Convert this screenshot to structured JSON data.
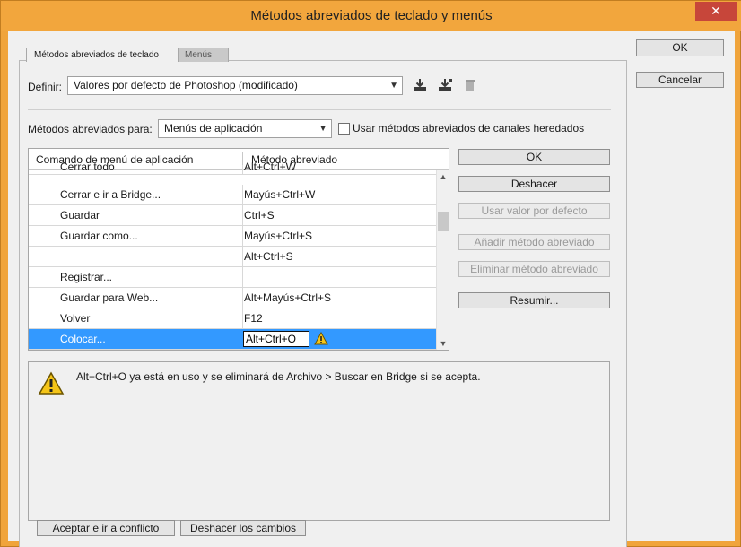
{
  "window": {
    "title": "Métodos abreviados de teclado y menús",
    "close_glyph": "✕"
  },
  "tabs": [
    {
      "label": "Métodos abreviados de teclado",
      "active": true
    },
    {
      "label": "Menús",
      "active": false
    }
  ],
  "define": {
    "label": "Definir:",
    "value": "Valores por defecto de Photoshop (modificado)",
    "icons": [
      "save-set-icon",
      "save-as-set-icon",
      "delete-set-icon"
    ]
  },
  "shortcuts_for": {
    "label": "Métodos abreviados para:",
    "value": "Menús de aplicación",
    "checkbox_label": "Usar métodos abreviados de canales heredados",
    "checkbox_checked": false
  },
  "table": {
    "columns": [
      "Comando de menú de aplicación",
      "Método abreviado"
    ],
    "rows": [
      {
        "command": "Cerrar todo",
        "shortcut": "Alt+Ctrl+W"
      },
      {
        "command": "Cerrar e ir a Bridge...",
        "shortcut": "Mayús+Ctrl+W"
      },
      {
        "command": "Guardar",
        "shortcut": "Ctrl+S"
      },
      {
        "command": "Guardar como...",
        "shortcut": "Mayús+Ctrl+S"
      },
      {
        "command": "",
        "shortcut": "Alt+Ctrl+S"
      },
      {
        "command": "Registrar...",
        "shortcut": ""
      },
      {
        "command": "Guardar para Web...",
        "shortcut": "Alt+Mayús+Ctrl+S"
      },
      {
        "command": "Volver",
        "shortcut": "F12"
      },
      {
        "command": "Colocar...",
        "shortcut": "Alt+Ctrl+O",
        "selected": true,
        "editing": true,
        "warning": true
      }
    ]
  },
  "side_buttons": {
    "ok": "OK",
    "undo": "Deshacer",
    "use_default": "Usar valor por defecto",
    "add_shortcut": "Añadir método abreviado",
    "delete_shortcut": "Eliminar método abreviado",
    "summarize": "Resumir..."
  },
  "message": "Alt+Ctrl+O ya está en uso y se eliminará de Archivo > Buscar en Bridge si se acepta.",
  "bottom_buttons": {
    "accept_conflict": "Aceptar e ir a conflicto",
    "undo_changes": "Deshacer los cambios"
  },
  "dialog_buttons": {
    "ok": "OK",
    "cancel": "Cancelar"
  },
  "colors": {
    "title_bar": "#f2a63d",
    "selection": "#3399ff",
    "close": "#c7463a",
    "warning": "#f5c518"
  }
}
